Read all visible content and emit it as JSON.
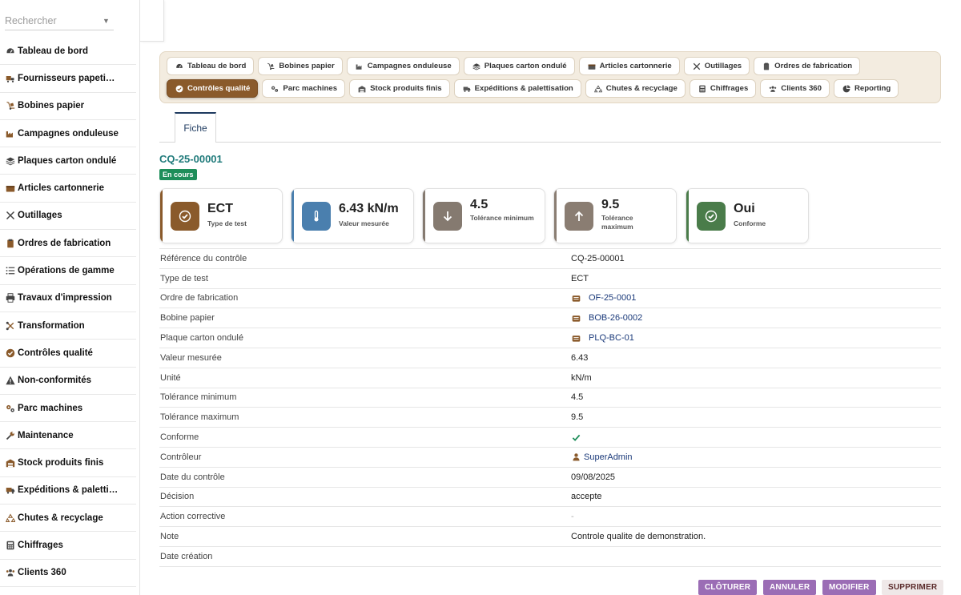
{
  "search": {
    "placeholder": "Rechercher"
  },
  "sidebar": {
    "items": [
      {
        "label": "Tableau de bord",
        "icon": "gauge-icon"
      },
      {
        "label": "Fournisseurs papeti…",
        "icon": "truck-loading-icon"
      },
      {
        "label": "Bobines papier",
        "icon": "dolly-icon"
      },
      {
        "label": "Campagnes onduleuse",
        "icon": "industry-icon"
      },
      {
        "label": "Plaques carton ondulé",
        "icon": "layers-icon"
      },
      {
        "label": "Articles cartonnerie",
        "icon": "box-icon"
      },
      {
        "label": "Outillages",
        "icon": "tools-icon"
      },
      {
        "label": "Ordres de fabrication",
        "icon": "clipboard-icon"
      },
      {
        "label": "Opérations de gamme",
        "icon": "list-icon"
      },
      {
        "label": "Travaux d'impression",
        "icon": "print-icon"
      },
      {
        "label": "Transformation",
        "icon": "scissors-icon"
      },
      {
        "label": "Contrôles qualité",
        "icon": "check-circle-icon"
      },
      {
        "label": "Non-conformités",
        "icon": "warning-icon"
      },
      {
        "label": "Parc machines",
        "icon": "cogs-icon"
      },
      {
        "label": "Maintenance",
        "icon": "wrench-icon"
      },
      {
        "label": "Stock produits finis",
        "icon": "warehouse-icon"
      },
      {
        "label": "Expéditions & paletti…",
        "icon": "shipping-icon"
      },
      {
        "label": "Chutes & recyclage",
        "icon": "recycle-icon"
      },
      {
        "label": "Chiffrages",
        "icon": "calculator-icon"
      },
      {
        "label": "Clients 360",
        "icon": "users-icon"
      }
    ]
  },
  "nav": {
    "pills": [
      {
        "label": "Tableau de bord",
        "icon": "gauge-icon",
        "active": false
      },
      {
        "label": "Bobines papier",
        "icon": "dolly-icon",
        "active": false
      },
      {
        "label": "Campagnes onduleuse",
        "icon": "industry-icon",
        "active": false
      },
      {
        "label": "Plaques carton ondulé",
        "icon": "layers-icon",
        "active": false
      },
      {
        "label": "Articles cartonnerie",
        "icon": "box-icon",
        "active": false
      },
      {
        "label": "Outillages",
        "icon": "tools-icon",
        "active": false
      },
      {
        "label": "Ordres de fabrication",
        "icon": "clipboard-icon",
        "active": false
      },
      {
        "label": "Contrôles qualité",
        "icon": "check-circle-icon",
        "active": true
      },
      {
        "label": "Parc machines",
        "icon": "cogs-icon",
        "active": false
      },
      {
        "label": "Stock produits finis",
        "icon": "warehouse-icon",
        "active": false
      },
      {
        "label": "Expéditions & palettisation",
        "icon": "shipping-icon",
        "active": false
      },
      {
        "label": "Chutes & recyclage",
        "icon": "recycle-icon",
        "active": false
      },
      {
        "label": "Chiffrages",
        "icon": "calculator-icon",
        "active": false
      },
      {
        "label": "Clients 360",
        "icon": "users-icon",
        "active": false
      },
      {
        "label": "Reporting",
        "icon": "chart-pie-icon",
        "active": false
      }
    ]
  },
  "tab": {
    "label": "Fiche"
  },
  "record": {
    "title": "CQ-25-00001",
    "status": "En cours"
  },
  "cards": [
    {
      "value": "ECT",
      "label": "Type de test",
      "icon": "check-circle-icon",
      "color": "#8a5a2b"
    },
    {
      "value": "6.43 kN/m",
      "label": "Valeur mesurée",
      "icon": "thermometer-icon",
      "color": "#4a7fae"
    },
    {
      "value": "4.5",
      "label": "Tolérance minimum",
      "icon": "arrow-down-icon",
      "color": "#857a70"
    },
    {
      "value": "9.5",
      "label": "Tolérance maximum",
      "icon": "arrow-up-icon",
      "color": "#8a7d72"
    },
    {
      "value": "Oui",
      "label": "Conforme",
      "icon": "check-circle-icon",
      "color": "#4a7c4a"
    }
  ],
  "rows": [
    {
      "key": "Référence du contrôle",
      "value": "CQ-25-00001"
    },
    {
      "key": "Type de test",
      "value": "ECT"
    },
    {
      "key": "Ordre de fabrication",
      "value": "OF-25-0001",
      "link": true
    },
    {
      "key": "Bobine papier",
      "value": "BOB-26-0002",
      "link": true
    },
    {
      "key": "Plaque carton ondulé",
      "value": "PLQ-BC-01",
      "link": true
    },
    {
      "key": "Valeur mesurée",
      "value": "6.43"
    },
    {
      "key": "Unité",
      "value": "kN/m"
    },
    {
      "key": "Tolérance minimum",
      "value": "4.5"
    },
    {
      "key": "Tolérance maximum",
      "value": "9.5"
    },
    {
      "key": "Conforme",
      "value": "",
      "check": true
    },
    {
      "key": "Contrôleur",
      "value": "SuperAdmin",
      "user": true
    },
    {
      "key": "Date du contrôle",
      "value": "09/08/2025"
    },
    {
      "key": "Décision",
      "value": "accepte"
    },
    {
      "key": "Action corrective",
      "value": "-",
      "dash": true
    },
    {
      "key": "Note",
      "value": "Controle qualite de demonstration."
    },
    {
      "key": "Date création",
      "value": ""
    }
  ],
  "buttons": {
    "close": "CLÔTURER",
    "cancel": "ANNULER",
    "edit": "MODIFIER",
    "delete": "SUPPRIMER"
  },
  "colors": {
    "accent": "#8a5a2b",
    "status_green": "#1e8e5a",
    "button_purple": "#9b6db5",
    "link": "#1b3a7a",
    "title_teal": "#1f7a7a"
  }
}
